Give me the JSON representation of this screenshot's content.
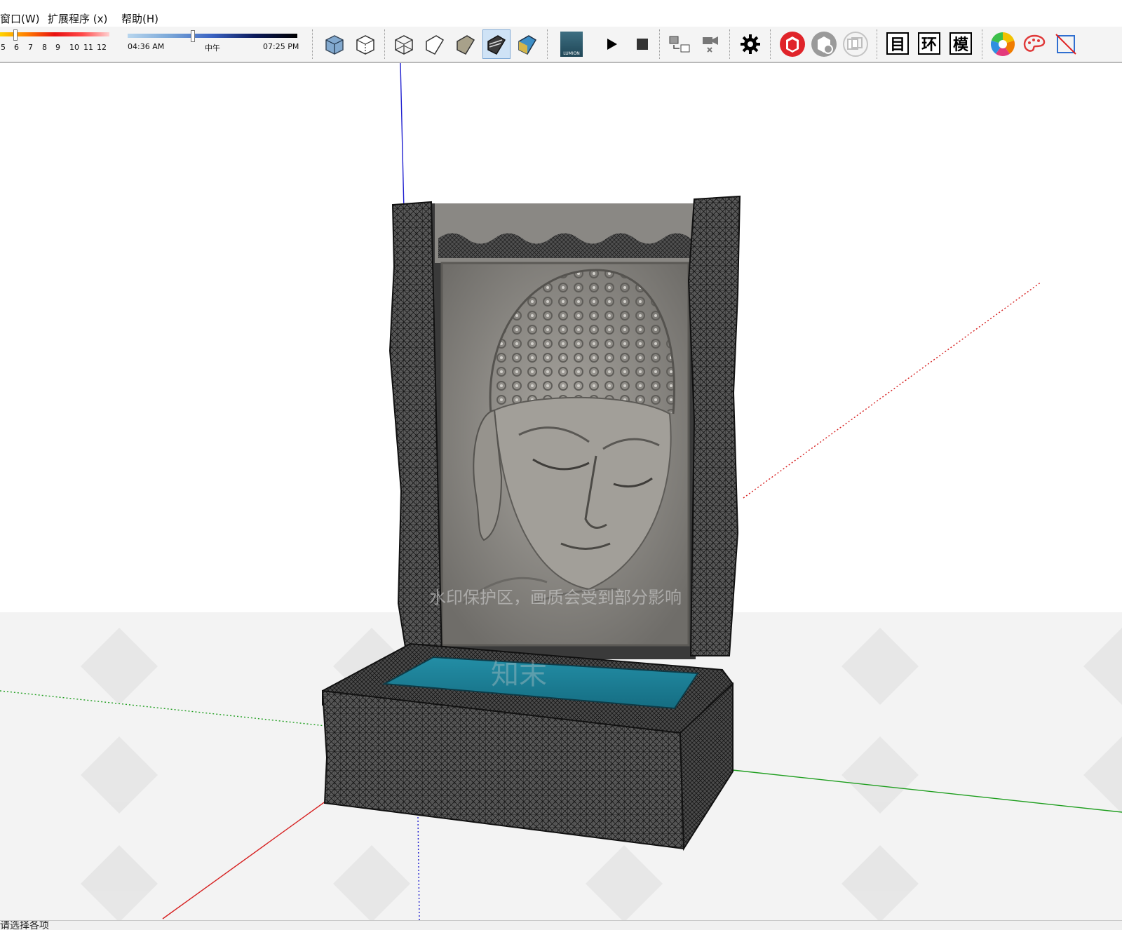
{
  "menubar": {
    "items": [
      {
        "label": "窗口(W)"
      },
      {
        "label": "扩展程序 (x)"
      },
      {
        "label": "帮助(H)"
      }
    ]
  },
  "toolbar": {
    "shadow_month_slider": {
      "numbers": [
        "5",
        "6",
        "7",
        "8",
        "9",
        "10",
        "11",
        "12"
      ],
      "value_fraction": 0.12
    },
    "shadow_time_slider": {
      "start_time": "04:36 AM",
      "noon_label": "中午",
      "end_time": "07:25 PM",
      "value_fraction": 0.39
    },
    "style_buttons": [
      {
        "icon": "xray-style-icon"
      },
      {
        "icon": "back-edges-style-icon"
      },
      {
        "icon": "wireframe-style-icon"
      },
      {
        "icon": "hidden-line-style-icon"
      },
      {
        "icon": "shaded-style-icon"
      },
      {
        "icon": "shaded-with-textures-style-icon",
        "active": true
      },
      {
        "icon": "monochrome-style-icon"
      }
    ],
    "lumion_label": "LUMION",
    "cjk_buttons": [
      "目",
      "环",
      "模"
    ]
  },
  "viewport": {
    "watermark_notice": "水印保护区，画质会受到部分影响",
    "watermark_brand": "知末",
    "colors": {
      "background": "#ffffff",
      "ground": "#f3f3f3",
      "axis_red": "#d61f1f",
      "axis_green": "#1e9e1e",
      "axis_blue": "#2020d0",
      "water": "#1e7f96",
      "stone": "#4a4a4a",
      "relief": "#8e8c88"
    }
  },
  "statusbar": {
    "text": "请选择各项"
  }
}
